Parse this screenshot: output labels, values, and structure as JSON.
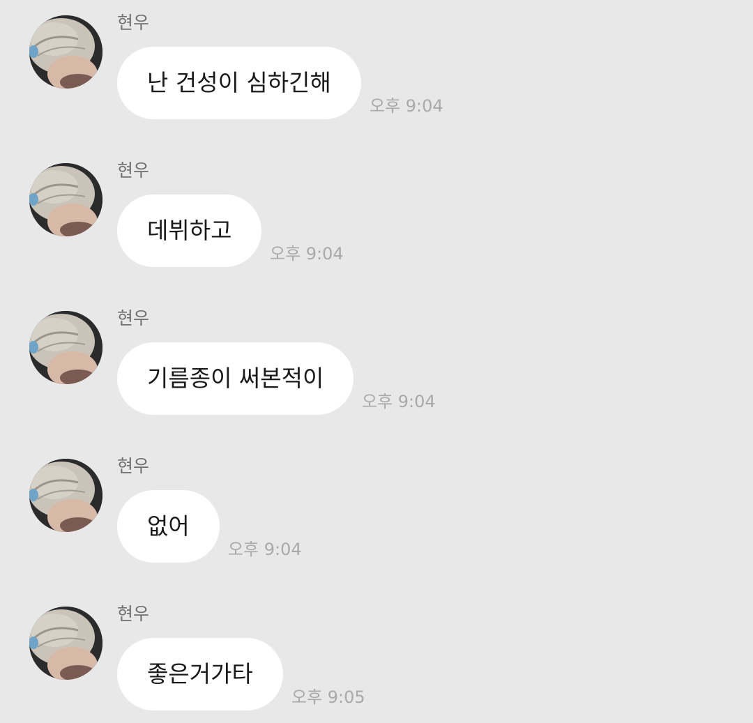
{
  "chat": {
    "messages": [
      {
        "sender": "현우",
        "text": "난 건성이 심하긴해",
        "time": "오후 9:04"
      },
      {
        "sender": "현우",
        "text": "데뷔하고",
        "time": "오후 9:04"
      },
      {
        "sender": "현우",
        "text": "기름종이 써본적이",
        "time": "오후 9:04"
      },
      {
        "sender": "현우",
        "text": "없어",
        "time": "오후 9:04"
      },
      {
        "sender": "현우",
        "text": "좋은거가타",
        "time": "오후 9:05"
      }
    ]
  },
  "colors": {
    "background": "#e8e8e8",
    "bubble": "#ffffff",
    "sender_text": "#6f6f6f",
    "time_text": "#a9a9a9",
    "message_text": "#1a1a1a"
  },
  "icons": {
    "avatar": "profile-photo-avatar"
  }
}
